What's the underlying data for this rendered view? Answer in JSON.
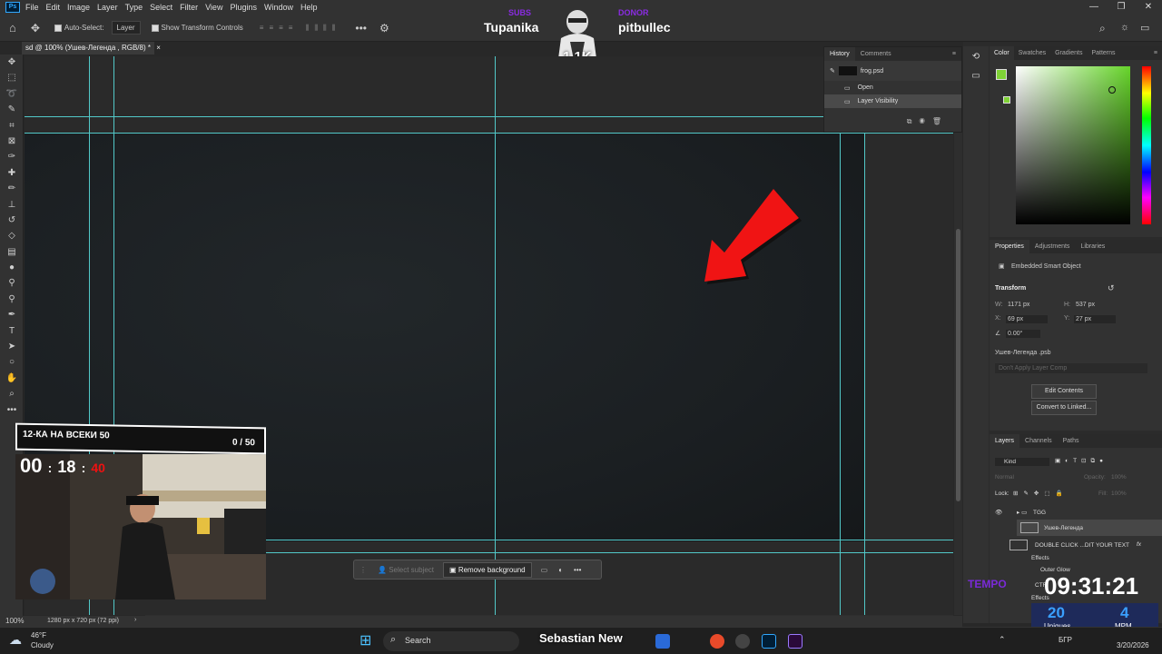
{
  "menu": {
    "logo": "Ps",
    "items": [
      "File",
      "Edit",
      "Image",
      "Layer",
      "Type",
      "Select",
      "Filter",
      "View",
      "Plugins",
      "Window",
      "Help"
    ]
  },
  "window_controls": [
    "—",
    "❐",
    "✕"
  ],
  "options": {
    "auto_select_label": "Auto-Select:",
    "auto_select_value": "Layer",
    "show_transform": "Show Transform Controls"
  },
  "stream_top": {
    "left_name": "Tupanika",
    "left_tag": "SUBS",
    "right_name": "pitbullec",
    "right_tag": "DONOR",
    "count": "1.1K"
  },
  "doc_tab": {
    "label": "sd @ 100% (Ушев-Легенда  , RGB/8) *",
    "close": "×"
  },
  "history": {
    "tabs": [
      "History",
      "Comments"
    ],
    "snapshot": "frog.psd",
    "steps": [
      "Open",
      "Layer Visibility"
    ]
  },
  "color_panel": {
    "tabs": [
      "Color",
      "Swatches",
      "Gradients",
      "Patterns"
    ],
    "fg": "#7fd236"
  },
  "properties": {
    "tabs": [
      "Properties",
      "Adjustments",
      "Libraries"
    ],
    "type": "Embedded Smart Object",
    "section": "Transform",
    "w_label": "W:",
    "w": "1171 px",
    "h_label": "H:",
    "h": "537 px",
    "x_label": "X:",
    "x": "69 px",
    "y_label": "Y:",
    "y": "27 px",
    "angle": "0.00°",
    "file": "Ушев-Легенда  .psb",
    "comp": "Don't Apply Layer Comp",
    "btn_edit": "Edit Contents",
    "btn_convert": "Convert to Linked..."
  },
  "layers": {
    "tabs": [
      "Layers",
      "Channels",
      "Paths"
    ],
    "kind": "Kind",
    "blend": "Normal",
    "opacity_label": "Opacity:",
    "opacity": "100%",
    "lock_label": "Lock:",
    "fill_label": "Fill:",
    "fill": "100%",
    "group": "TGG",
    "layer_selected": "Ушев-Легенда",
    "layer_text": "DOUBLE CLICK ...DIT YOUR TEXT",
    "fx": "fx",
    "effects": "Effects",
    "outer_glow": "Outer Glow",
    "layer_cr": "CTR",
    "effects2": "Effects"
  },
  "context_bar": {
    "select_subject": "Select subject",
    "remove_bg": "Remove background",
    "more": "•••"
  },
  "status": {
    "zoom": "100%",
    "size": "1280 px x 720 px (72 ppi)"
  },
  "overlay_goal": {
    "title": "12-КА НА ВСЕКИ 50",
    "progress": "0 / 50",
    "timer_hh": "00",
    "timer_mm": "18",
    "timer_ss": "40"
  },
  "overlay_clock": {
    "label": "TEMPO",
    "time": "09:31:21",
    "uniques_num": "20",
    "uniques_label": "Uniques",
    "mpm_num": "4",
    "mpm_label": "MPM"
  },
  "taskbar": {
    "weather_temp": "46°F",
    "weather_desc": "Cloudy",
    "search": "Search",
    "center_text": "Sebastian New",
    "lang": "БГР",
    "date": "3/20/2026"
  }
}
